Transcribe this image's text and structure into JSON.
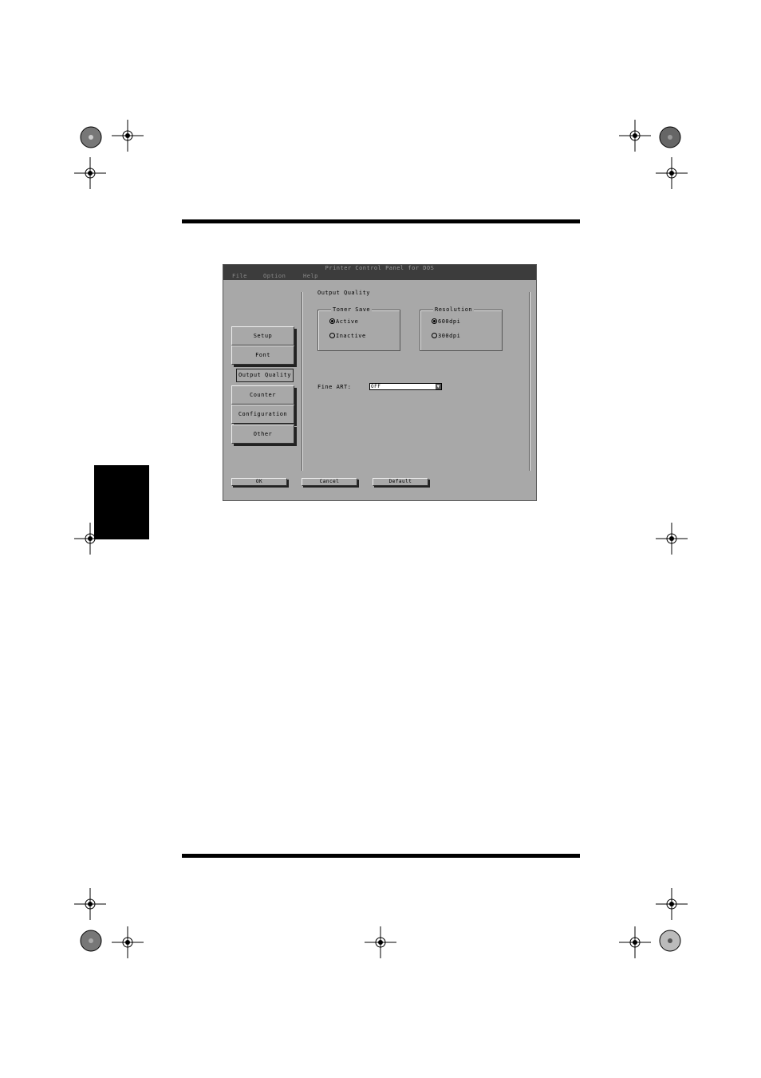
{
  "window": {
    "title": "Printer Control Panel for DOS",
    "menu": [
      "File",
      "Option",
      "Help"
    ]
  },
  "nav": {
    "items": [
      "Setup",
      "Font",
      "Output Quality",
      "Counter",
      "Configuration",
      "Other"
    ],
    "active": "Output Quality"
  },
  "panel": {
    "title": "Output Quality",
    "toner_save": {
      "label": "Toner Save",
      "options": [
        "Active",
        "Inactive"
      ],
      "selected": "Active"
    },
    "resolution": {
      "label": "Resolution",
      "options": [
        "600dpi",
        "300dpi"
      ],
      "selected": "600dpi"
    },
    "fine_art": {
      "label": "Fine ART:",
      "value": "OFF"
    }
  },
  "buttons": {
    "ok": "OK",
    "cancel": "Cancel",
    "default": "Default"
  }
}
